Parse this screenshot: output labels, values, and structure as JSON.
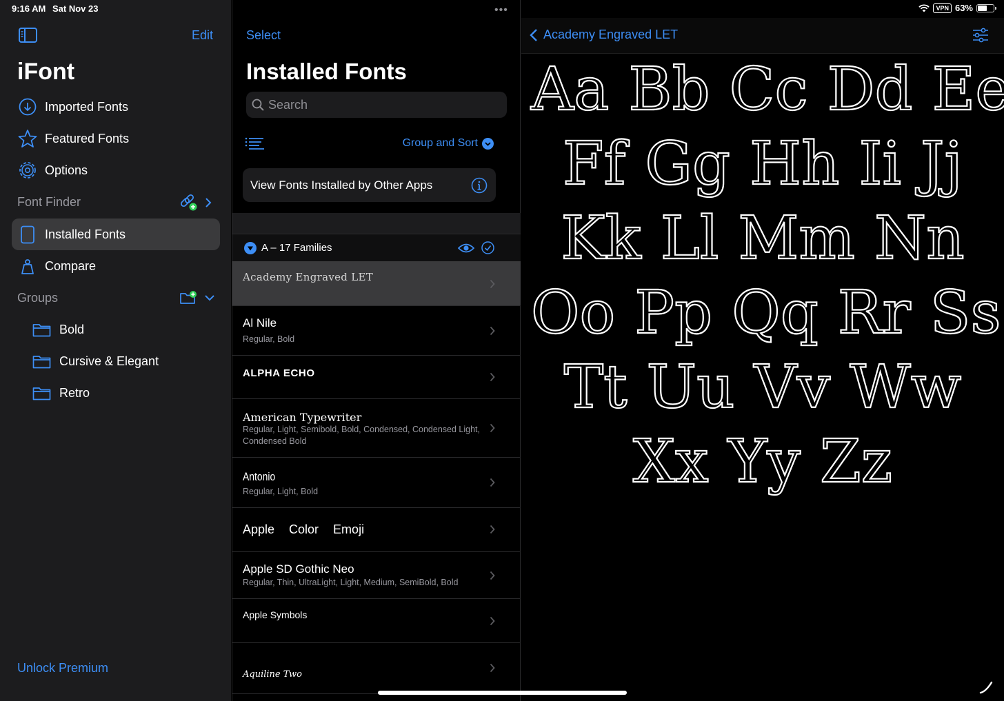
{
  "status_bar": {
    "time": "9:16 AM",
    "date": "Sat Nov 23",
    "vpn": "VPN",
    "battery": "63%",
    "battery_level": 0.63
  },
  "sidebar": {
    "edit_label": "Edit",
    "app_title": "iFont",
    "nav": [
      {
        "label": "Imported Fonts",
        "icon": "download-circle-icon"
      },
      {
        "label": "Featured Fonts",
        "icon": "star-icon"
      },
      {
        "label": "Options",
        "icon": "gear-icon"
      }
    ],
    "font_finder_label": "Font Finder",
    "finder_items": [
      {
        "label": "Installed Fonts",
        "icon": "ipad-icon",
        "selected": true
      },
      {
        "label": "Compare",
        "icon": "scale-icon",
        "selected": false
      }
    ],
    "groups_label": "Groups",
    "groups": [
      {
        "label": "Bold"
      },
      {
        "label": "Cursive & Elegant"
      },
      {
        "label": "Retro"
      }
    ],
    "unlock_label": "Unlock Premium"
  },
  "middle": {
    "select_label": "Select",
    "title": "Installed Fonts",
    "search_placeholder": "Search",
    "group_sort_label": "Group and Sort",
    "view_other_label": "View Fonts Installed by Other Apps",
    "section_label": "A – 17 Families",
    "fonts": [
      {
        "name": "Academy Engraved LET",
        "styles": ""
      },
      {
        "name": "Al Nile",
        "styles": "Regular, Bold"
      },
      {
        "name": "ALPHA ECHO",
        "styles": ""
      },
      {
        "name": "American Typewriter",
        "styles": "Regular, Light, Semibold, Bold, Condensed, Condensed Light, Condensed Bold"
      },
      {
        "name": "Antonio",
        "styles": "Regular, Light, Bold"
      },
      {
        "name": "Apple Color Emoji",
        "styles": ""
      },
      {
        "name": "Apple SD Gothic Neo",
        "styles": "Regular, Thin, UltraLight, Light, Medium, SemiBold, Bold"
      },
      {
        "name": "Apple Symbols",
        "styles": ""
      },
      {
        "name": "Aquiline Two",
        "styles": ""
      }
    ]
  },
  "detail": {
    "back_label": "Academy Engraved LET",
    "specimen_lines": [
      [
        "Aa",
        "Bb",
        "Cc",
        "Dd",
        "Ee"
      ],
      [
        "Ff",
        "Gg",
        "Hh",
        "Ii",
        "Jj"
      ],
      [
        "Kk",
        "Ll",
        "Mm",
        "Nn"
      ],
      [
        "Oo",
        "Pp",
        "Qq",
        "Rr",
        "Ss"
      ],
      [
        "Tt",
        "Uu",
        "Vv",
        "Ww"
      ],
      [
        "Xx",
        "Yy",
        "Zz"
      ]
    ]
  },
  "colors": {
    "accent": "#3d8ef5",
    "sidebar_bg": "#1c1c1e",
    "selected_bg": "#3a3a3c",
    "badge_green": "#30d158"
  }
}
